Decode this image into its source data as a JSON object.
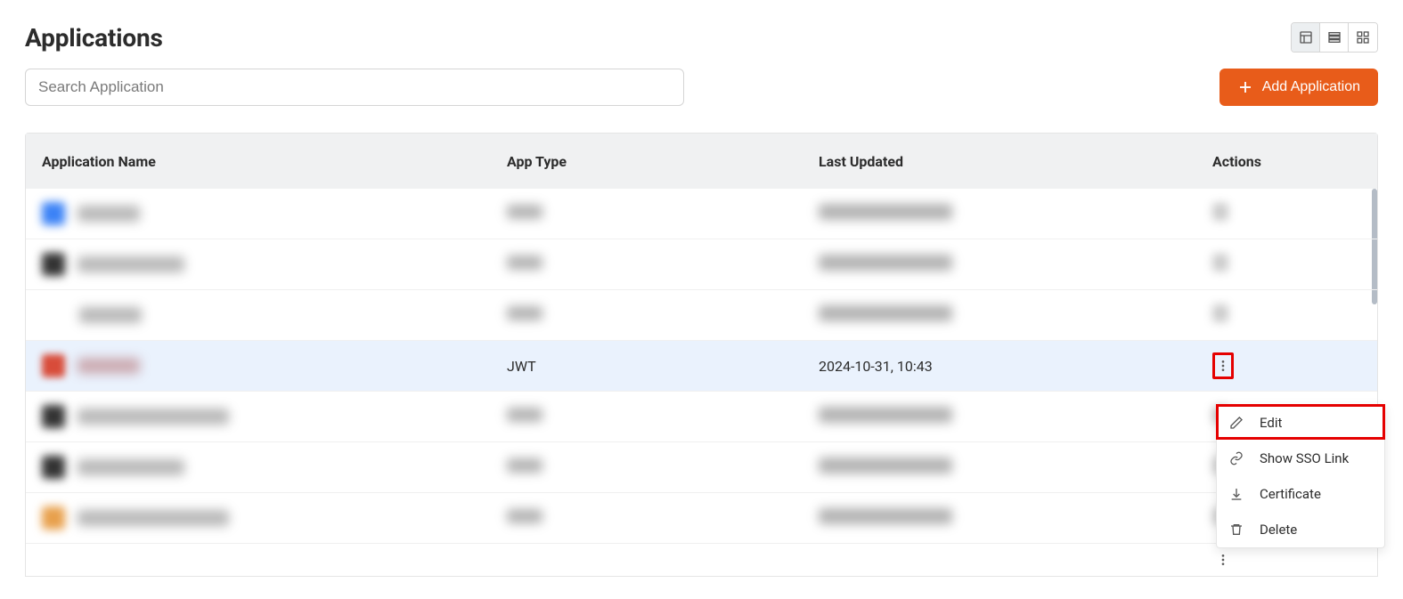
{
  "page": {
    "title": "Applications"
  },
  "search": {
    "placeholder": "Search Application"
  },
  "addButton": {
    "label": "Add Application"
  },
  "table": {
    "headers": {
      "name": "Application Name",
      "type": "App Type",
      "updated": "Last Updated",
      "actions": "Actions"
    },
    "rows": [
      {
        "highlighted": false
      },
      {
        "highlighted": false
      },
      {
        "highlighted": false
      },
      {
        "highlighted": true,
        "appType": "JWT",
        "lastUpdated": "2024-10-31, 10:43"
      },
      {
        "highlighted": false
      },
      {
        "highlighted": false
      },
      {
        "highlighted": false
      },
      {
        "highlighted": false
      }
    ]
  },
  "menu": {
    "edit": "Edit",
    "showSso": "Show SSO Link",
    "certificate": "Certificate",
    "delete": "Delete"
  }
}
